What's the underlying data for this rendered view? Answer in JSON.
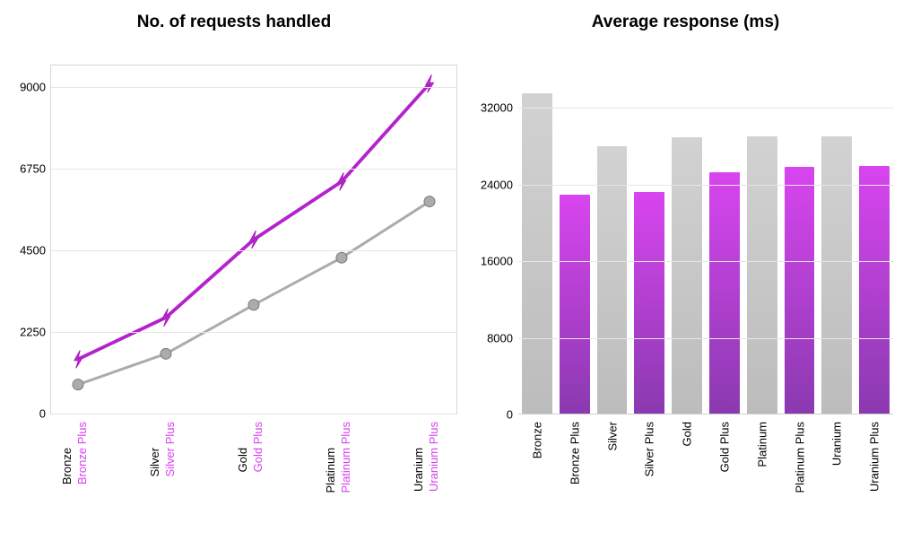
{
  "chart_data": [
    {
      "type": "line",
      "title": "No. of requests handled",
      "categories": [
        "Bronze",
        "Silver",
        "Gold",
        "Platinum",
        "Uranium"
      ],
      "categories_plus": [
        "Bronze Plus",
        "Silver Plus",
        "Gold Plus",
        "Platinum Plus",
        "Uranium Plus"
      ],
      "series": [
        {
          "name": "base",
          "color": "#ababab",
          "marker": "circle",
          "values": [
            800,
            1650,
            3000,
            4300,
            5850
          ]
        },
        {
          "name": "plus",
          "color": "#b422cb",
          "marker": "bolt",
          "values": [
            1500,
            2650,
            4800,
            6400,
            9100
          ]
        }
      ],
      "y_ticks": [
        0,
        2250,
        4500,
        6750,
        9000
      ],
      "ylim": [
        0,
        9600
      ],
      "xlabel": "",
      "ylabel": ""
    },
    {
      "type": "bar",
      "title": "Average response (ms)",
      "categories": [
        "Bronze",
        "Bronze Plus",
        "Silver",
        "Silver Plus",
        "Gold",
        "Gold Plus",
        "Platinum",
        "Platinum Plus",
        "Uranium",
        "Uranium Plus"
      ],
      "series": [
        {
          "name": "response_ms",
          "colors": [
            "gray",
            "purple",
            "gray",
            "purple",
            "gray",
            "purple",
            "gray",
            "purple",
            "gray",
            "purple"
          ],
          "values": [
            33400,
            22800,
            27900,
            23100,
            28800,
            25200,
            28900,
            25700,
            28900,
            25800
          ]
        }
      ],
      "y_ticks": [
        0,
        8000,
        16000,
        24000,
        32000
      ],
      "ylim": [
        0,
        36500
      ],
      "xlabel": "",
      "ylabel": ""
    }
  ]
}
